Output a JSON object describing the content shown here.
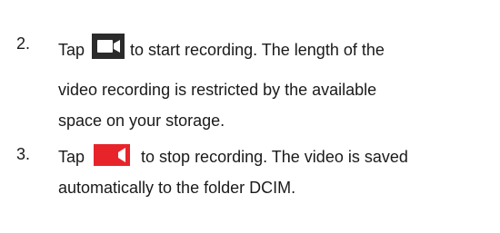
{
  "steps": [
    {
      "number": "2.",
      "before_icon": "Tap",
      "icon": "video-camera-icon",
      "icon_color": "#2b2b2b",
      "after_icon": "to start recording. The length of the",
      "lines": [
        "video recording is restricted by the available",
        "space on your storage."
      ]
    },
    {
      "number": "3.",
      "before_icon": "Tap",
      "icon": "video-camera-icon",
      "icon_color": "#e8242b",
      "after_icon": "to stop recording. The video is saved",
      "lines": [
        "automatically to the folder DCIM."
      ]
    }
  ]
}
